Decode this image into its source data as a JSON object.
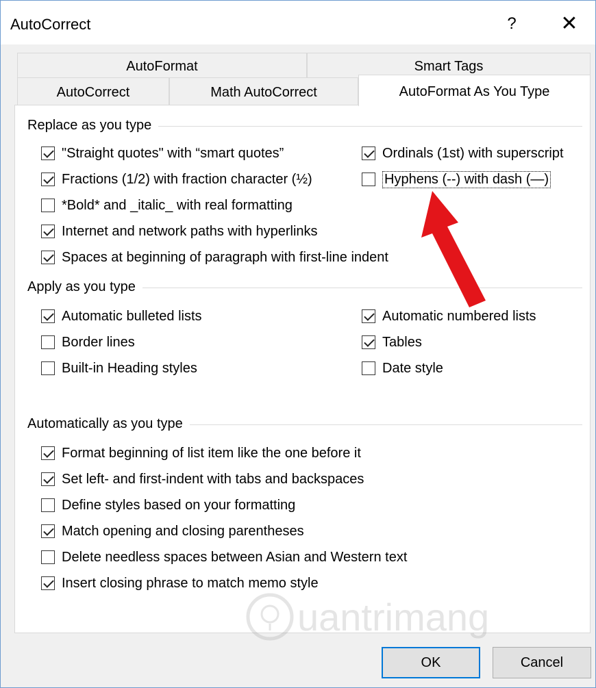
{
  "window": {
    "title": "AutoCorrect",
    "help_label": "?",
    "close_label": "✕"
  },
  "tabs": {
    "row1": [
      "AutoFormat",
      "Smart Tags"
    ],
    "row2": [
      "AutoCorrect",
      "Math AutoCorrect",
      "AutoFormat As You Type"
    ],
    "active": "AutoFormat As You Type"
  },
  "groups": {
    "replace": {
      "label": "Replace as you type",
      "items": [
        {
          "label": "\"Straight quotes\" with “smart quotes”",
          "checked": true
        },
        {
          "label": "Fractions (1/2) with fraction character (½)",
          "checked": true
        },
        {
          "label": "*Bold* and _italic_ with real formatting",
          "checked": false
        },
        {
          "label": "Internet and network paths with hyperlinks",
          "checked": true
        },
        {
          "label": "Spaces at beginning of paragraph with first-line indent",
          "checked": true
        },
        {
          "label": "Ordinals (1st) with superscript",
          "checked": true
        },
        {
          "label": "Hyphens (--) with dash (—)",
          "checked": false
        }
      ]
    },
    "apply": {
      "label": "Apply as you type",
      "items": [
        {
          "label": "Automatic bulleted lists",
          "checked": true
        },
        {
          "label": "Border lines",
          "checked": false
        },
        {
          "label": "Built-in Heading styles",
          "checked": false
        },
        {
          "label": "Automatic numbered lists",
          "checked": true
        },
        {
          "label": "Tables",
          "checked": true
        },
        {
          "label": "Date style",
          "checked": false
        }
      ]
    },
    "auto": {
      "label": "Automatically as you type",
      "items": [
        {
          "label": "Format beginning of list item like the one before it",
          "checked": true
        },
        {
          "label": "Set left- and first-indent with tabs and backspaces",
          "checked": true
        },
        {
          "label": "Define styles based on your formatting",
          "checked": false
        },
        {
          "label": "Match opening and closing parentheses",
          "checked": true
        },
        {
          "label": "Delete needless spaces between Asian and Western text",
          "checked": false
        },
        {
          "label": "Insert closing phrase to match memo style",
          "checked": true
        }
      ]
    }
  },
  "buttons": {
    "ok": "OK",
    "cancel": "Cancel"
  },
  "watermark": {
    "text": "uantrimang"
  },
  "colors": {
    "accent": "#0078d7",
    "arrow": "#e3151a",
    "watermark": "#9a9a9a"
  }
}
